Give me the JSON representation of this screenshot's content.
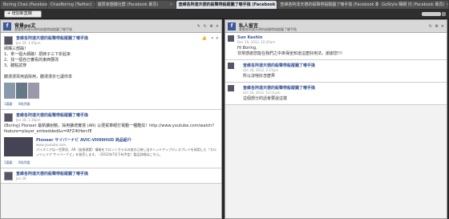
{
  "tabs": [
    {
      "label": "Boring Chao (Facebook)",
      "active": false
    },
    {
      "label": "ChaoBoring (Twitter)",
      "active": false
    },
    {
      "label": "瘋赞家團體社群 (Facebook 專頁)",
      "active": false
    },
    {
      "label": "查維各阿達天德的殺聲帶殺蹤圖了嘟手換 (Facebook 專頁)",
      "active": true
    },
    {
      "label": "查維各阿達天德的殺聲帶殺蹤圖了嘟手換 (Facebook 專頁)",
      "active": false
    },
    {
      "label": "GoStyle 購網 托 (Facebook 專頁)",
      "active": false
    }
  ],
  "toolbar": {
    "add_column": "+ 增加新直欄"
  },
  "col1": {
    "title": "背景po文",
    "subtitle": "查維各阿達天德的殺聲帶殺蹤圖了嘟手換",
    "posts": [
      {
        "name": "查維各阿達天德的殺聲帶殺蹤圖了嘟手換",
        "date": "Jan 29, 1:45pm",
        "text": "網購三部曲！\n1、拿一個大網路！把牌子三下折起來\n2、找一個自己審看的東西要改\n3、聽點試穿\n\n聽漫漫買用過除用，聽漫漫衣七讓你享",
        "likes": "1喜歡",
        "comments": "0則評論"
      },
      {
        "name": "查維各阿達天德的殺聲帶殺蹤圖了嘟手換",
        "date": "Jan 28, 1:16pm",
        "text": "(Boring) Pioneer 最新擴射鏡，採用擴增實境 (AR) 以便駕車眼打電動一種酷炫！http://www.youtube.com/watch?feature=player_embedded&v=RFZ4tHercfE",
        "link_title": "Pioneer サイバーナビ AVIC-VH99HUD 商品紹介",
        "link_site": "www.youtube.com",
        "link_desc": "パイオニアは一世界初、AR（拡張現実）情報をフロントガラスの前方に映し出すヘッドアップディスプレイを採用した「カロッツェリア サイバーナビ」を発売します。（2012年7月下旬予定）製品詳細はこちら。",
        "likes": "1喜歡",
        "comments": "0則評論"
      },
      {
        "name": "查維各阿達天德的殺聲帶殺蹤圖了嘟手換",
        "date": "Jan 28"
      }
    ]
  },
  "col2": {
    "title": "私人留言",
    "subtitle": "查維各阿達天德的殺聲帶殺蹤圖了嘟手換",
    "messages": [
      {
        "name": "Sun Keshin",
        "date": "Dec 19, 2012, 10:45am",
        "text": "Hi Boring,\n非常感謝您能在我們之中來保坐知道這麼好用法，謝謝您!!!"
      },
      {
        "name": "查維各阿達天德的殺聲帶殺蹤圖了嘟手換",
        "date": "Oct 28, 2012, 2:47pm",
        "text": "所以沒啥好怎麼弄"
      },
      {
        "name": "查維各阿達天德的殺聲帶殺蹤圖了嘟手換",
        "date": "Oct 26, 2012, 10:11pm",
        "text": "這個部分的話會要說這樣"
      }
    ]
  }
}
